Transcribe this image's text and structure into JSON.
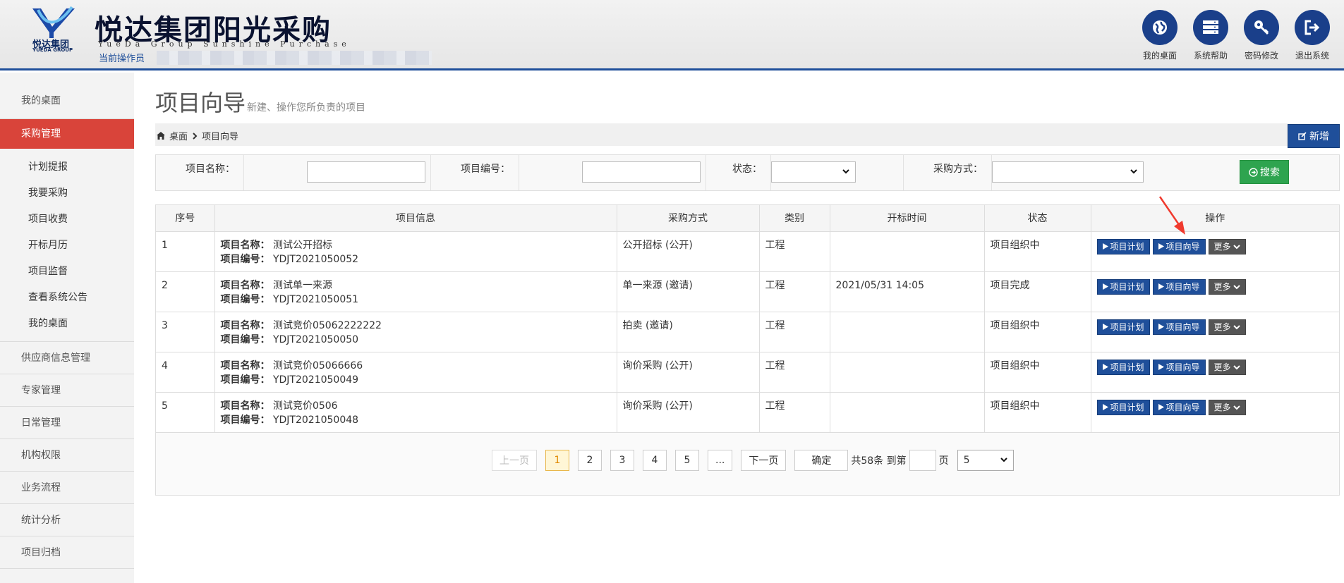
{
  "header": {
    "logo_cn": "悦达集团",
    "logo_en": "YUEDA GROUP",
    "title": "悦达集团阳光采购",
    "subtitle": "YueDa Group Sunshine Purchase",
    "operator_label": "当前操作员",
    "actions": [
      {
        "label": "我的桌面",
        "icon": "globe-icon"
      },
      {
        "label": "系统帮助",
        "icon": "server-icon"
      },
      {
        "label": "密码修改",
        "icon": "key-icon"
      },
      {
        "label": "退出系统",
        "icon": "logout-icon"
      }
    ]
  },
  "sidebar": {
    "items": [
      {
        "label": "我的桌面"
      },
      {
        "label": "采购管理",
        "active": true
      },
      {
        "label": "供应商信息管理"
      },
      {
        "label": "专家管理"
      },
      {
        "label": "日常管理"
      },
      {
        "label": "机构权限"
      },
      {
        "label": "业务流程"
      },
      {
        "label": "统计分析"
      },
      {
        "label": "项目归档"
      }
    ],
    "sub_items": [
      {
        "label": "计划提报"
      },
      {
        "label": "我要采购"
      },
      {
        "label": "项目收费"
      },
      {
        "label": "开标月历"
      },
      {
        "label": "项目监督"
      },
      {
        "label": "查看系统公告"
      },
      {
        "label": "我的桌面"
      }
    ]
  },
  "page": {
    "title": "项目向导",
    "subtitle": "新建、操作您所负责的项目",
    "breadcrumb_home": "桌面",
    "breadcrumb_current": "项目向导",
    "new_button": "新增"
  },
  "filter": {
    "name_label": "项目名称：",
    "name_value": "",
    "code_label": "项目编号：",
    "code_value": "",
    "status_label": "状态：",
    "status_value": "",
    "method_label": "采购方式：",
    "method_value": "",
    "search_button": "搜索"
  },
  "table": {
    "headers": [
      "序号",
      "项目信息",
      "采购方式",
      "类别",
      "开标时间",
      "状态",
      "操作"
    ],
    "name_prefix": "项目名称：",
    "code_prefix": "项目编号：",
    "op_plan": "项目计划",
    "op_guide": "项目向导",
    "op_more": "更多",
    "rows": [
      {
        "no": "1",
        "name": "测试公开招标",
        "code": "YDJT2021050052",
        "method": "公开招标 (公开)",
        "category": "工程",
        "open_time": "",
        "status": "项目组织中"
      },
      {
        "no": "2",
        "name": "测试单一来源",
        "code": "YDJT2021050051",
        "method": "单一来源 (邀请)",
        "category": "工程",
        "open_time": "2021/05/31 14:05",
        "status": "项目完成"
      },
      {
        "no": "3",
        "name": "测试竞价05062222222",
        "code": "YDJT2021050050",
        "method": "拍卖 (邀请)",
        "category": "工程",
        "open_time": "",
        "status": "项目组织中"
      },
      {
        "no": "4",
        "name": "测试竞价05066666",
        "code": "YDJT2021050049",
        "method": "询价采购 (公开)",
        "category": "工程",
        "open_time": "",
        "status": "项目组织中"
      },
      {
        "no": "5",
        "name": "测试竞价0506",
        "code": "YDJT2021050048",
        "method": "询价采购 (公开)",
        "category": "工程",
        "open_time": "",
        "status": "项目组织中"
      }
    ]
  },
  "pagination": {
    "prev": "上一页",
    "pages": [
      "1",
      "2",
      "3",
      "4",
      "5",
      "..."
    ],
    "current": "1",
    "next": "下一页",
    "confirm": "确定",
    "total_text": "共58条 到第",
    "page_unit": "页",
    "page_size": "5"
  },
  "colors": {
    "brand_blue": "#1f4f9a",
    "active_red": "#d9443a",
    "search_green": "#2ea44f"
  }
}
